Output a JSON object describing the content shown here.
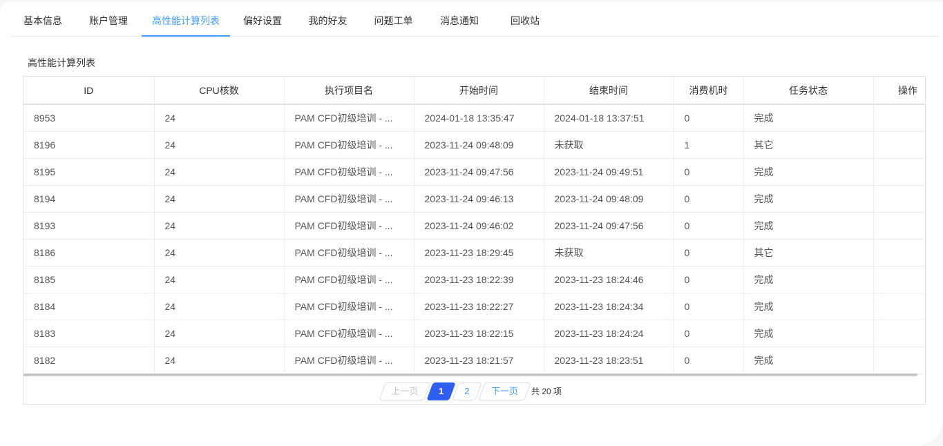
{
  "tabs": [
    {
      "label": "基本信息"
    },
    {
      "label": "账户管理"
    },
    {
      "label": "高性能计算列表"
    },
    {
      "label": "偏好设置"
    },
    {
      "label": "我的好友"
    },
    {
      "label": "问题工单"
    },
    {
      "label": "消息通知"
    },
    {
      "label": "回收站"
    }
  ],
  "active_tab": "高性能计算列表",
  "section_title": "高性能计算列表",
  "table": {
    "headers": [
      "ID",
      "CPU核数",
      "执行项目名",
      "开始时间",
      "结束时间",
      "消费机时",
      "任务状态",
      "操作"
    ],
    "rows": [
      [
        "8953",
        "24",
        "PAM CFD初级培训 - ...",
        "2024-01-18 13:35:47",
        "2024-01-18 13:37:51",
        "0",
        "完成",
        ""
      ],
      [
        "8196",
        "24",
        "PAM CFD初级培训 - ...",
        "2023-11-24 09:48:09",
        "未获取",
        "1",
        "其它",
        ""
      ],
      [
        "8195",
        "24",
        "PAM CFD初级培训 - ...",
        "2023-11-24 09:47:56",
        "2023-11-24 09:49:51",
        "0",
        "完成",
        ""
      ],
      [
        "8194",
        "24",
        "PAM CFD初级培训 - ...",
        "2023-11-24 09:46:13",
        "2023-11-24 09:48:09",
        "0",
        "完成",
        ""
      ],
      [
        "8193",
        "24",
        "PAM CFD初级培训 - ...",
        "2023-11-24 09:46:02",
        "2023-11-24 09:47:56",
        "0",
        "完成",
        ""
      ],
      [
        "8186",
        "24",
        "PAM CFD初级培训 - ...",
        "2023-11-23 18:29:45",
        "未获取",
        "0",
        "其它",
        ""
      ],
      [
        "8185",
        "24",
        "PAM CFD初级培训 - ...",
        "2023-11-23 18:22:39",
        "2023-11-23 18:24:46",
        "0",
        "完成",
        ""
      ],
      [
        "8184",
        "24",
        "PAM CFD初级培训 - ...",
        "2023-11-23 18:22:27",
        "2023-11-23 18:24:34",
        "0",
        "完成",
        ""
      ],
      [
        "8183",
        "24",
        "PAM CFD初级培训 - ...",
        "2023-11-23 18:22:15",
        "2023-11-23 18:24:24",
        "0",
        "完成",
        ""
      ],
      [
        "8182",
        "24",
        "PAM CFD初级培训 - ...",
        "2023-11-23 18:21:57",
        "2023-11-23 18:23:51",
        "0",
        "完成",
        ""
      ]
    ]
  },
  "pagination": {
    "prev_label": "上一页",
    "pages": [
      "1",
      "2"
    ],
    "current_page": "1",
    "next_label": "下一页",
    "total_label": "共 20 项"
  },
  "colors": {
    "accent": "#409eff",
    "current_page_bg": "#2f5ef2"
  }
}
